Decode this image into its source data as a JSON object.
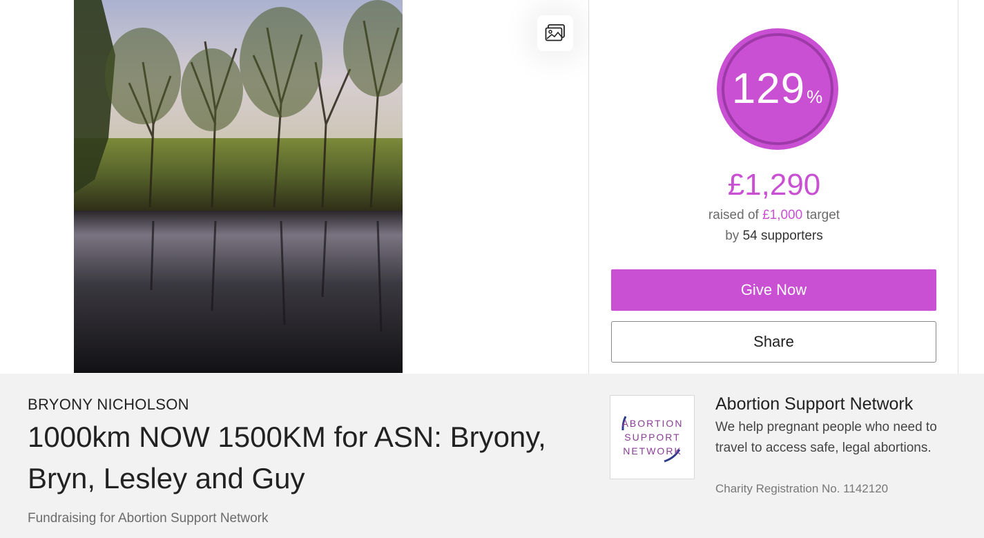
{
  "gallery": {
    "icon": "images-icon"
  },
  "progress": {
    "percent": "129",
    "percent_symbol": "%",
    "fraction": 1.29,
    "color": "#c94fd3"
  },
  "totals": {
    "raised": "£1,290",
    "raised_prefix": "raised of",
    "target": "£1,000",
    "target_suffix": "target",
    "by_prefix": "by",
    "supporters": "54 supporters"
  },
  "actions": {
    "give_label": "Give Now",
    "share_label": "Share"
  },
  "fundraiser": {
    "name": "BRYONY NICHOLSON",
    "title": "1000km NOW 1500KM for ASN: Bryony, Bryn, Lesley and Guy",
    "fundraising_for": "Fundraising for Abortion Support Network"
  },
  "charity": {
    "logo_lines": [
      "ABORTION",
      "SUPPORT",
      "NETWORK"
    ],
    "name": "Abortion Support Network",
    "description": "We help pregnant people who need to travel to access safe, legal abortions.",
    "registration": "Charity Registration No. 1142120"
  },
  "colors": {
    "accent": "#c94fd3",
    "logo_text": "#8a3d96",
    "logo_arc": "#2e3a8c"
  }
}
